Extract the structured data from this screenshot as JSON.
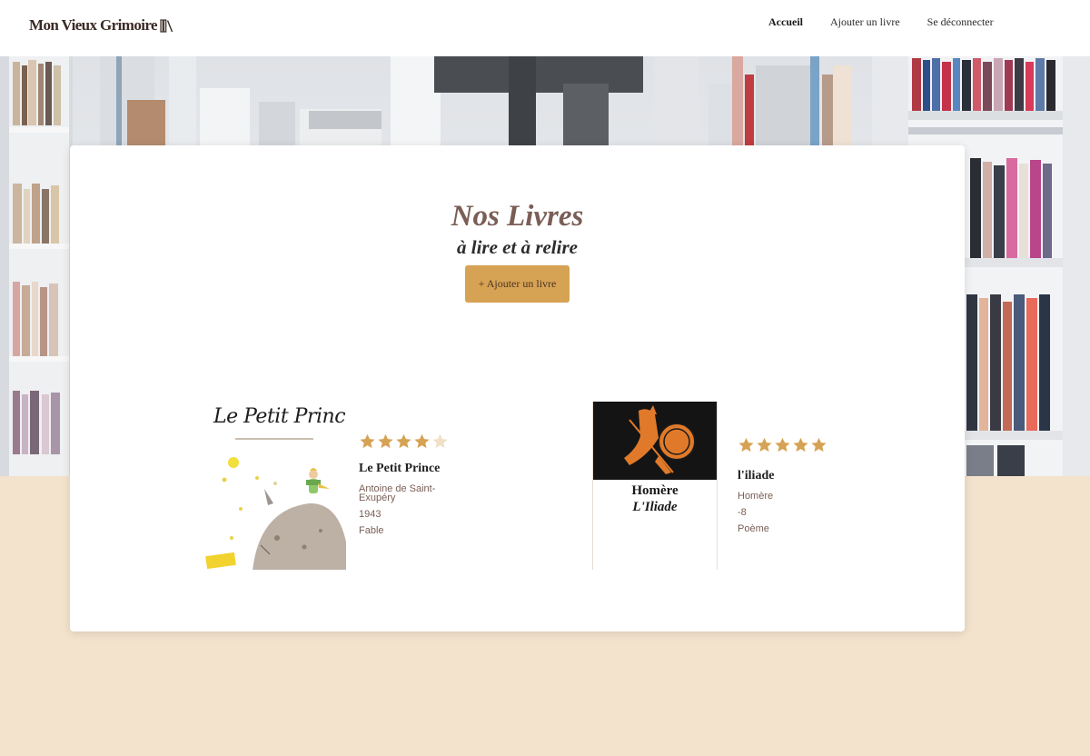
{
  "header": {
    "brand": "Mon Vieux Grimoire",
    "nav": [
      {
        "label": "Accueil",
        "active": true
      },
      {
        "label": "Ajouter un livre",
        "active": false
      },
      {
        "label": "Se déconnecter",
        "active": false
      }
    ]
  },
  "main": {
    "title": "Nos Livres",
    "subtitle": "à lire et à relire",
    "add_button": "+ Ajouter un livre"
  },
  "books": [
    {
      "title": "Le Petit Prince",
      "author": "Antoine de Saint-Exupéry",
      "year": "1943",
      "genre": "Fable",
      "rating": 4,
      "rating_max": 5,
      "cover_text": "Le Petit Prince"
    },
    {
      "title": "l'iliade",
      "author": "Homère",
      "year": "-8",
      "genre": "Poème",
      "rating": 5,
      "rating_max": 5,
      "cover_author": "Homère",
      "cover_title": "L'Iliade"
    }
  ],
  "colors": {
    "accent": "#d6a254",
    "star_filled": "#d6a254",
    "star_empty": "#f0e0c6",
    "page_bg": "#f3e3cd",
    "title": "#7a5e55"
  }
}
